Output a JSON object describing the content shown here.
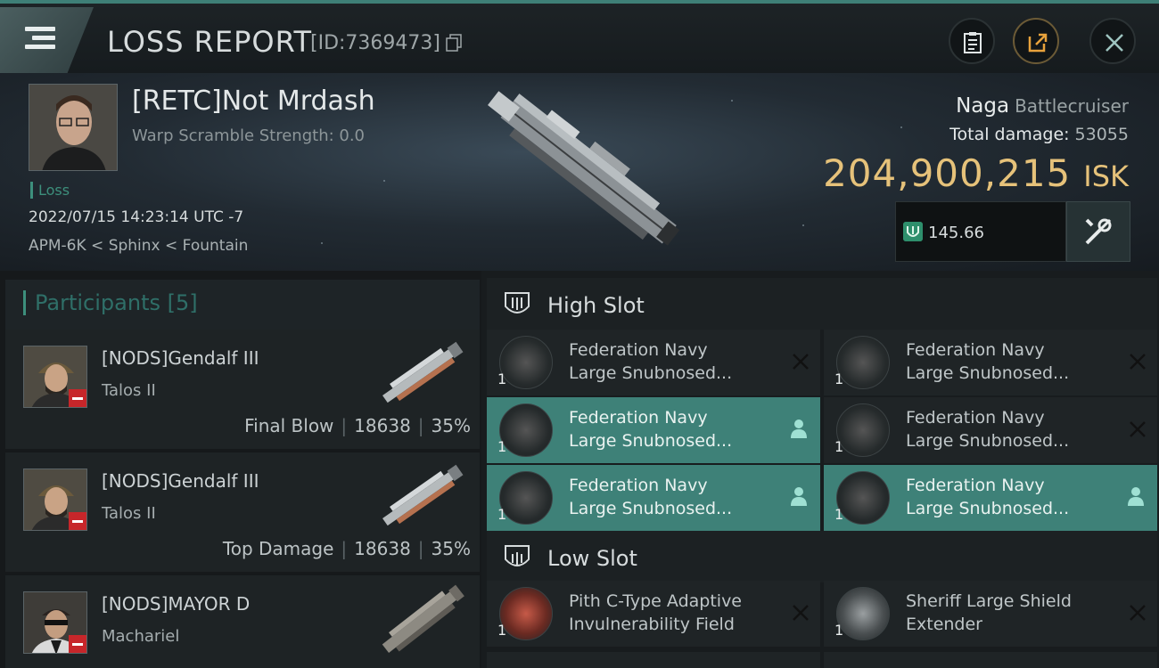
{
  "header": {
    "title": "LOSS REPORT",
    "report_id": "[ID:7369473]"
  },
  "victim": {
    "name": "[RETC]Not Mrdash",
    "warp": "Warp Scramble Strength: 0.0",
    "status": "Loss",
    "datetime": "2022/07/15 14:23:14 UTC -7",
    "location": "APM-6K < Sphinx < Fountain",
    "ship_name": "Naga",
    "ship_class": "Battlecruiser",
    "total_damage_label": "Total damage:",
    "total_damage": "53055",
    "isk_value": "204,900,215",
    "isk_unit": "ISK",
    "fitting_value": "145.66"
  },
  "participants": {
    "title": "Participants",
    "count": "[5]",
    "rows": [
      {
        "name": "[NODS]Gendalf III",
        "ship": "Talos II",
        "tag": "Final Blow",
        "damage": "18638",
        "pct": "35%"
      },
      {
        "name": "[NODS]Gendalf III",
        "ship": "Talos II",
        "tag": "Top Damage",
        "damage": "18638",
        "pct": "35%"
      },
      {
        "name": "[NODS]MAYOR D",
        "ship": "Machariel",
        "tag": "",
        "damage": "",
        "pct": ""
      }
    ]
  },
  "slots": {
    "high": {
      "label": "High Slot",
      "items": [
        {
          "line1": "Federation Navy",
          "line2": "Large Snubnosed...",
          "qty": "1",
          "state": "destroyed"
        },
        {
          "line1": "Federation Navy",
          "line2": "Large Snubnosed...",
          "qty": "1",
          "state": "destroyed"
        },
        {
          "line1": "Federation Navy",
          "line2": "Large Snubnosed...",
          "qty": "1",
          "state": "dropped"
        },
        {
          "line1": "Federation Navy",
          "line2": "Large Snubnosed...",
          "qty": "1",
          "state": "destroyed"
        },
        {
          "line1": "Federation Navy",
          "line2": "Large Snubnosed...",
          "qty": "1",
          "state": "dropped"
        },
        {
          "line1": "Federation Navy",
          "line2": "Large Snubnosed...",
          "qty": "1",
          "state": "dropped"
        }
      ]
    },
    "low": {
      "label": "Low Slot",
      "items": [
        {
          "line1": "Pith C-Type Adaptive",
          "line2": "Invulnerability Field",
          "qty": "1",
          "state": "destroyed"
        },
        {
          "line1": "Sheriff Large Shield",
          "line2": "Extender",
          "qty": "1",
          "state": "destroyed"
        }
      ]
    }
  },
  "colors": {
    "accent": "#3e8178",
    "isk": "#e6c27a",
    "loss": "#3d8f7c",
    "flag": "#c7262a"
  },
  "icons": [
    "menu-icon",
    "copy-icon",
    "clipboard-icon",
    "share-icon",
    "close-icon",
    "fitting-icon",
    "tools-icon",
    "high-slot-icon",
    "low-slot-icon",
    "person-icon",
    "destroyed-x-icon"
  ]
}
